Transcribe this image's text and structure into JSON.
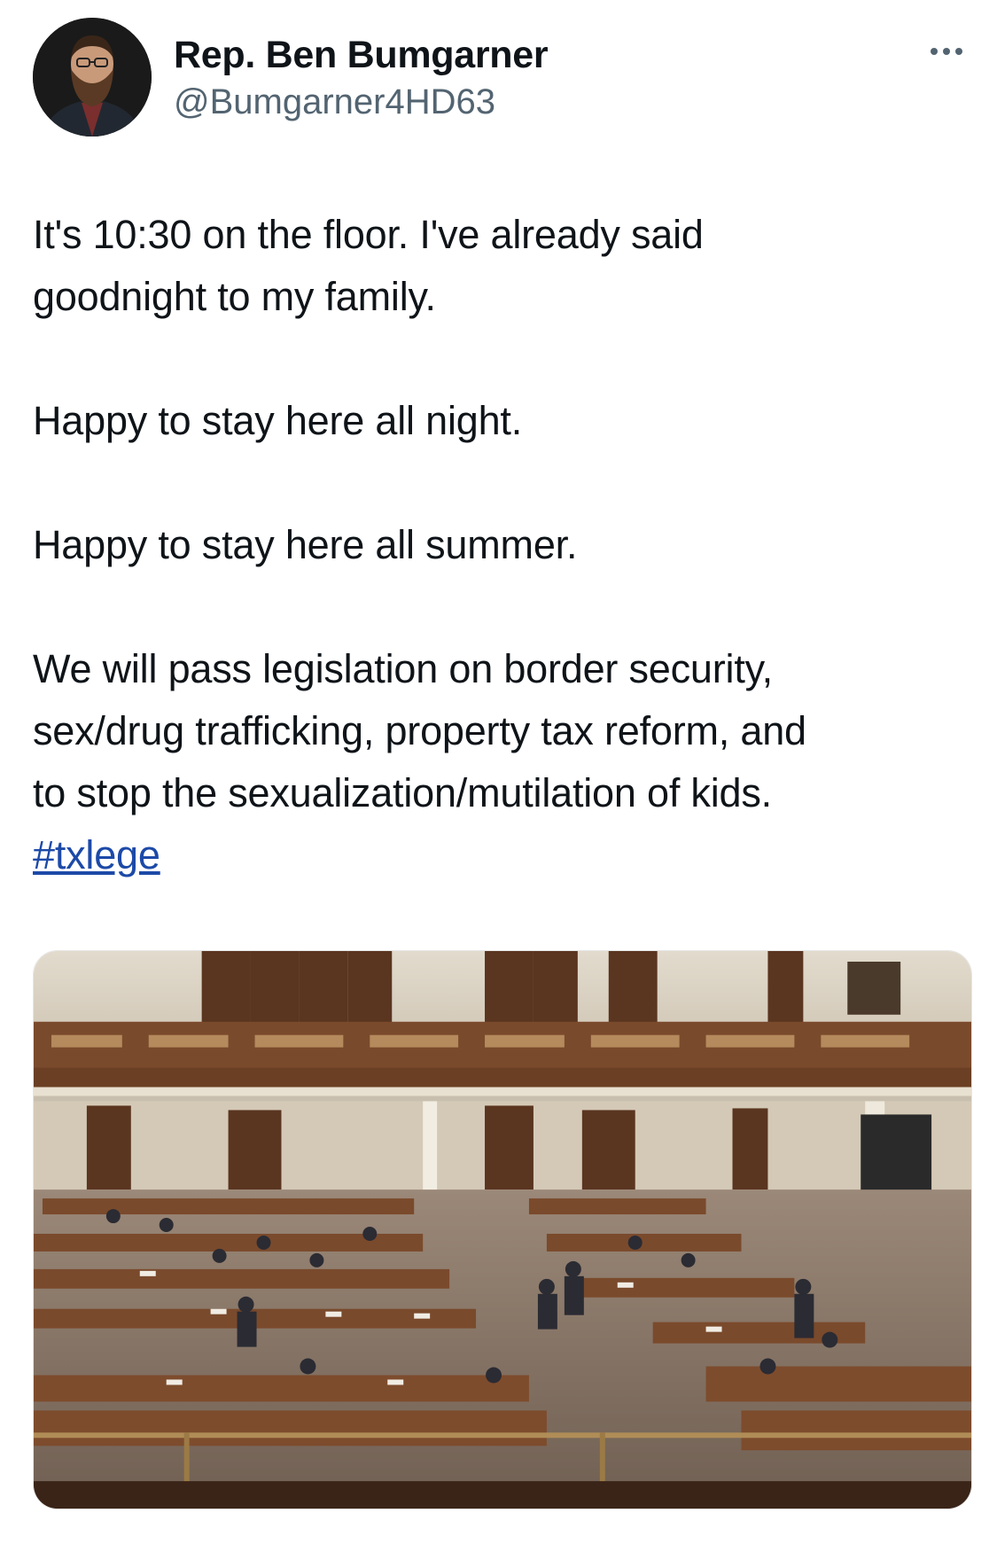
{
  "author": {
    "name": "Rep. Ben Bumgarner",
    "handle": "@Bumgarner4HD63",
    "avatar_icon": "profile-photo"
  },
  "header": {
    "more_icon": "ellipsis-icon"
  },
  "tweet": {
    "lines": [
      "It's 10:30 on the floor. I've already said",
      "goodnight to my family.",
      "Happy to stay here all night.",
      "Happy to stay here all summer.",
      "We will pass legislation on border security,",
      "sex/drug trafficking, property tax reform, and",
      "to stop the sexualization/mutilation of kids."
    ],
    "hashtag": "#txlege"
  },
  "media": {
    "type": "photo",
    "colors": {
      "wall": "#d8cfc0",
      "wood": "#6b3f24",
      "carpet": "#8a7868",
      "desk": "#7a4a2c",
      "rail": "#b08d57"
    }
  },
  "colors": {
    "text": "#0f1419",
    "secondary": "#536471",
    "link": "#1d4aa8"
  }
}
